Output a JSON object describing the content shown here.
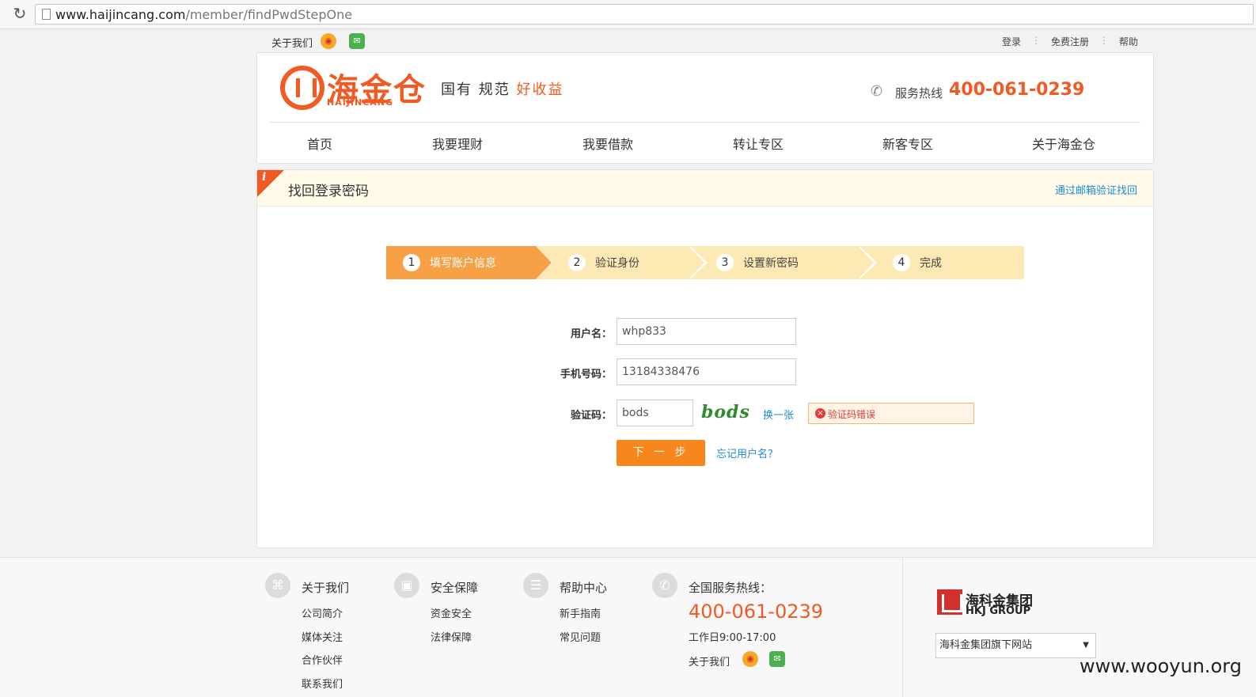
{
  "browser": {
    "url_host": "www.haijincang.com",
    "url_path": "/member/findPwdStepOne"
  },
  "topbar": {
    "about": "关于我们",
    "login": "登录",
    "register": "免费注册",
    "help": "帮助",
    "separator": "⋮"
  },
  "header": {
    "logo_cn": "海金仓",
    "logo_en": "HAIJINCANG",
    "slogan_a": "国有 规范",
    "slogan_b": "好收益",
    "hotline_label": "服务热线",
    "hotline_number": "400-061-0239"
  },
  "nav": [
    "首页",
    "我要理财",
    "我要借款",
    "转让专区",
    "新客专区",
    "关于海金仓"
  ],
  "panel": {
    "title": "找回登录密码",
    "email_link": "通过邮箱验证找回",
    "corner_icon": "i"
  },
  "steps": [
    {
      "num": "1",
      "label": "填写账户信息",
      "active": true
    },
    {
      "num": "2",
      "label": "验证身份",
      "active": false
    },
    {
      "num": "3",
      "label": "设置新密码",
      "active": false
    },
    {
      "num": "4",
      "label": "完成",
      "active": false
    }
  ],
  "form": {
    "username_label": "用户名：",
    "username_value": "whp833",
    "phone_label": "手机号码：",
    "phone_value": "13184338476",
    "captcha_label": "验证码：",
    "captcha_value": "bods",
    "captcha_image_text": "bods",
    "change_captcha": "换一张",
    "error_icon": "×",
    "error_text": "验证码错误",
    "next_button": "下 一 步",
    "forgot_username": "忘记用户名？"
  },
  "footer": {
    "about": {
      "title": "关于我们",
      "links": [
        "公司简介",
        "媒体关注",
        "合作伙伴",
        "联系我们"
      ]
    },
    "security": {
      "title": "安全保障",
      "links": [
        "资金安全",
        "法律保障"
      ]
    },
    "help": {
      "title": "帮助中心",
      "links": [
        "新手指南",
        "常见问题"
      ]
    },
    "service": {
      "title": "全国服务热线：",
      "number": "400-061-0239",
      "hours": "工作日9:00-17:00",
      "about": "关于我们"
    },
    "group": {
      "name_cn": "海科金集团",
      "name_en": "HKJ GROUP",
      "select_value": "海科金集团旗下网站"
    }
  },
  "watermark": "www.wooyun.org",
  "colors": {
    "brand_orange": "#f15a22",
    "button_orange": "#f7861d",
    "step_active": "#f7a147",
    "step_inactive": "#fde9b4",
    "link_blue": "#1a8bd8",
    "error_red": "#e53935"
  }
}
